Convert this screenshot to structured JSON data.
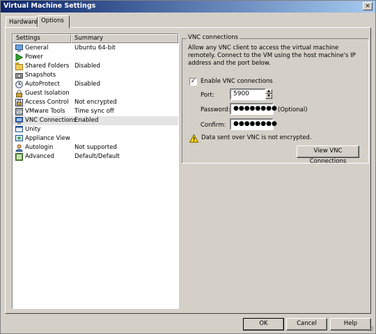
{
  "window": {
    "title": "Virtual Machine Settings",
    "close": "×"
  },
  "tabs": [
    {
      "label": "Hardware"
    },
    {
      "label": "Options"
    }
  ],
  "list": {
    "headers": {
      "settings": "Settings",
      "summary": "Summary"
    },
    "items": [
      {
        "name": "General",
        "summary": "Ubuntu 64-bit",
        "icon": "monitor-icon"
      },
      {
        "name": "Power",
        "summary": "",
        "icon": "power-play-icon"
      },
      {
        "name": "Shared Folders",
        "summary": "Disabled",
        "icon": "folder-icon"
      },
      {
        "name": "Snapshots",
        "summary": "",
        "icon": "snapshot-icon"
      },
      {
        "name": "AutoProtect",
        "summary": "Disabled",
        "icon": "autoprotect-icon"
      },
      {
        "name": "Guest Isolation",
        "summary": "",
        "icon": "lock-icon"
      },
      {
        "name": "Access Control",
        "summary": "Not encrypted",
        "icon": "access-control-icon"
      },
      {
        "name": "VMware Tools",
        "summary": "Time sync off",
        "icon": "vm-tools-icon"
      },
      {
        "name": "VNC Connections",
        "summary": "Enabled",
        "icon": "vnc-icon"
      },
      {
        "name": "Unity",
        "summary": "",
        "icon": "unity-icon"
      },
      {
        "name": "Appliance View",
        "summary": "",
        "icon": "appliance-icon"
      },
      {
        "name": "Autologin",
        "summary": "Not supported",
        "icon": "user-icon"
      },
      {
        "name": "Advanced",
        "summary": "Default/Default",
        "icon": "advanced-icon"
      }
    ],
    "selected_index": 8
  },
  "vnc": {
    "group_title": "VNC connections",
    "description": "Allow any VNC client to access the virtual machine remotely. Connect to the VM using the host machine's IP address and the port below.",
    "enable_label": "Enable VNC connections",
    "enable_checked": true,
    "port_label": "Port:",
    "port_value": "5900",
    "password_label": "Password:",
    "password_value": "●●●●●●●●",
    "optional_label": "(Optional)",
    "confirm_label": "Confirm:",
    "confirm_value": "●●●●●●●●",
    "warning_text": "Data sent over VNC is not encrypted.",
    "view_button": "View VNC Connections"
  },
  "buttons": {
    "ok": "OK",
    "cancel": "Cancel",
    "help": "Help"
  }
}
